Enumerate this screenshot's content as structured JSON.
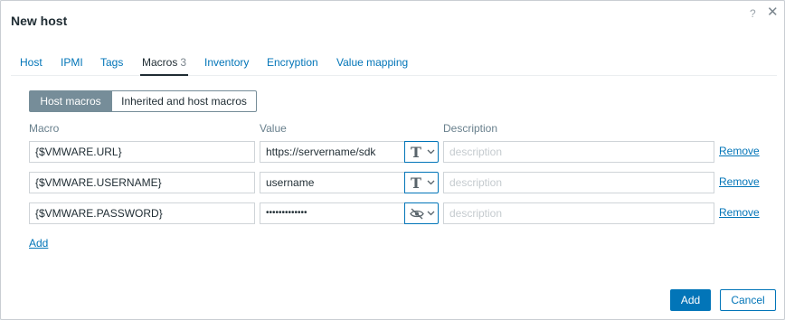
{
  "dialog": {
    "title": "New host",
    "help_glyph": "?",
    "close_glyph": "✕"
  },
  "tabs": [
    {
      "label": "Host"
    },
    {
      "label": "IPMI"
    },
    {
      "label": "Tags"
    },
    {
      "label": "Macros",
      "count": "3",
      "active": true
    },
    {
      "label": "Inventory"
    },
    {
      "label": "Encryption"
    },
    {
      "label": "Value mapping"
    }
  ],
  "macro_view": {
    "host_macros": "Host macros",
    "inherited": "Inherited and host macros"
  },
  "columns": {
    "macro": "Macro",
    "value": "Value",
    "description": "Description"
  },
  "macros": [
    {
      "macro": "{$VMWARE.URL}",
      "value": "https://servername/sdk",
      "value_type": "text-icon",
      "description_placeholder": "description",
      "remove": "Remove"
    },
    {
      "macro": "{$VMWARE.USERNAME}",
      "value": "username",
      "value_type": "text-icon",
      "description_placeholder": "description",
      "remove": "Remove"
    },
    {
      "macro": "{$VMWARE.PASSWORD}",
      "value": "•••••••••••••",
      "value_type": "secret-eye-icon",
      "description_placeholder": "description",
      "remove": "Remove"
    }
  ],
  "text_type_glyph": "T",
  "add_link": "Add",
  "footer": {
    "add": "Add",
    "cancel": "Cancel"
  },
  "colors": {
    "link": "#0275b8",
    "segment_active": "#768d99",
    "text": "#1f2c33"
  }
}
